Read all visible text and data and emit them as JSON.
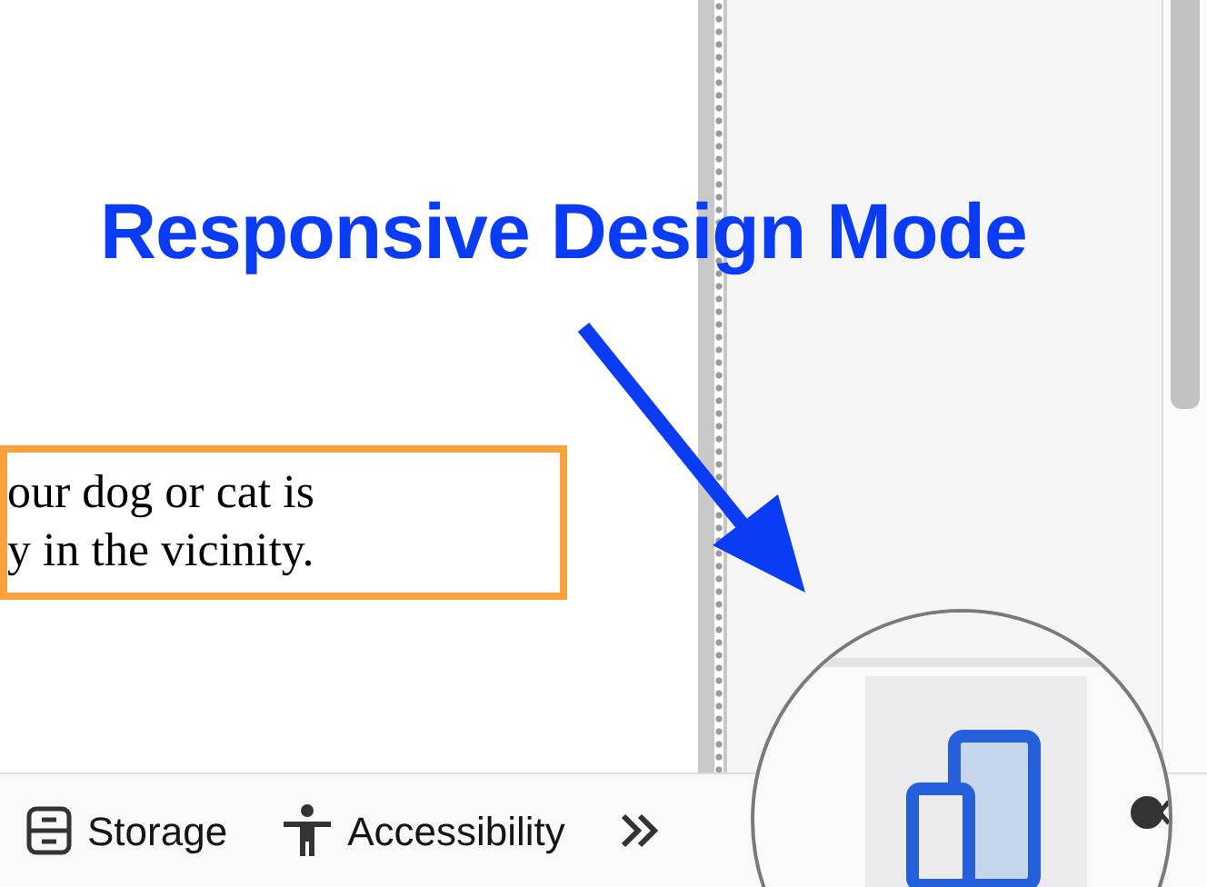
{
  "annotation": {
    "title": "Responsive Design Mode"
  },
  "page": {
    "text_lines": [
      "our dog or cat is",
      "y in the vicinity."
    ]
  },
  "toolbar": {
    "tabs": [
      {
        "kind": "storage",
        "label": "Storage",
        "selected": false
      },
      {
        "kind": "accessibility",
        "label": "Accessibility",
        "selected": false
      }
    ]
  },
  "magnifier": {
    "responsive_button": {
      "selected": true
    }
  }
}
